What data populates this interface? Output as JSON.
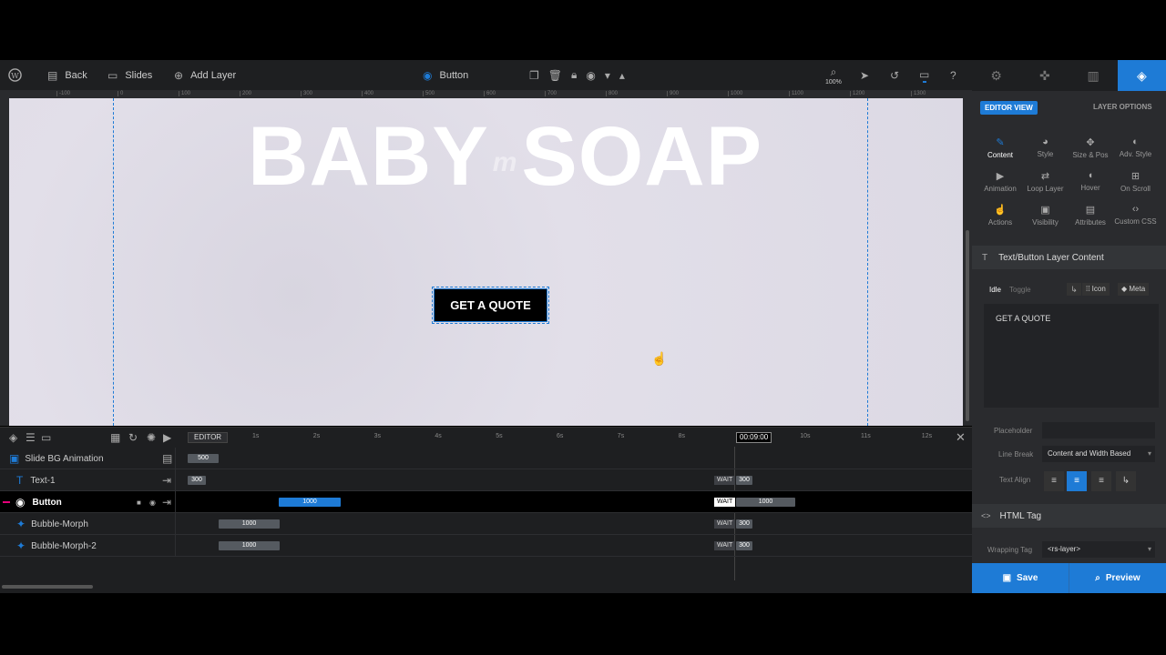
{
  "topbar": {
    "back": "Back",
    "slides": "Slides",
    "add_layer": "Add Layer",
    "layer_name": "Button",
    "zoom": "100%"
  },
  "ruler": {
    "ticks": [
      "-100",
      "0",
      "100",
      "200",
      "300",
      "400",
      "500",
      "600",
      "700",
      "800",
      "900",
      "1000",
      "1100",
      "1200",
      "1300"
    ]
  },
  "canvas": {
    "title_left": "BABY",
    "title_mid": "m",
    "title_right": "SOAP",
    "button_label": "GET A QUOTE"
  },
  "timeline": {
    "editor_label": "EDITOR",
    "time_marks": [
      "1s",
      "2s",
      "3s",
      "4s",
      "5s",
      "6s",
      "7s",
      "8s",
      "9s",
      "10s",
      "11s",
      "12s"
    ],
    "current_time": "00:09:00",
    "rows": [
      {
        "name": "Slide BG Animation",
        "bar": "500"
      },
      {
        "name": "Text-1",
        "bar": "300",
        "wait": "WAIT",
        "end": "300"
      },
      {
        "name": "Button",
        "bar": "1000",
        "wait": "WAIT",
        "end": "1000"
      },
      {
        "name": "Bubble-Morph",
        "bar": "1000",
        "wait": "WAIT",
        "end": "300"
      },
      {
        "name": "Bubble-Morph-2",
        "bar": "1000",
        "wait": "WAIT",
        "end": "300"
      }
    ]
  },
  "right_panel": {
    "editor_view": "EDITOR VIEW",
    "layer_options": "LAYER OPTIONS",
    "options": [
      {
        "label": "Content",
        "icon": "pencil-icon"
      },
      {
        "label": "Style",
        "icon": "palette-icon"
      },
      {
        "label": "Size & Pos",
        "icon": "move-icon"
      },
      {
        "label": "Adv. Style",
        "icon": "drop-icon"
      },
      {
        "label": "Animation",
        "icon": "play-icon"
      },
      {
        "label": "Loop Layer",
        "icon": "loop-icon"
      },
      {
        "label": "Hover",
        "icon": "mouse-icon"
      },
      {
        "label": "On Scroll",
        "icon": "scroll-icon"
      },
      {
        "label": "Actions",
        "icon": "hand-icon"
      },
      {
        "label": "Visibility",
        "icon": "eye-icon"
      },
      {
        "label": "Attributes",
        "icon": "doc-icon"
      },
      {
        "label": "Custom CSS",
        "icon": "code-icon"
      }
    ],
    "content_section": "Text/Button Layer Content",
    "idle": "Idle",
    "toggle": "Toggle",
    "icon_btn": "Icon",
    "meta_btn": "Meta",
    "text_value": "GET A QUOTE",
    "placeholder_label": "Placeholder",
    "line_break_label": "Line Break",
    "line_break_value": "Content and Width Based",
    "text_align_label": "Text Align",
    "html_tag_section": "HTML Tag",
    "wrapping_tag_label": "Wrapping Tag",
    "wrapping_tag_value": "<rs-layer>",
    "save": "Save",
    "preview": "Preview"
  }
}
